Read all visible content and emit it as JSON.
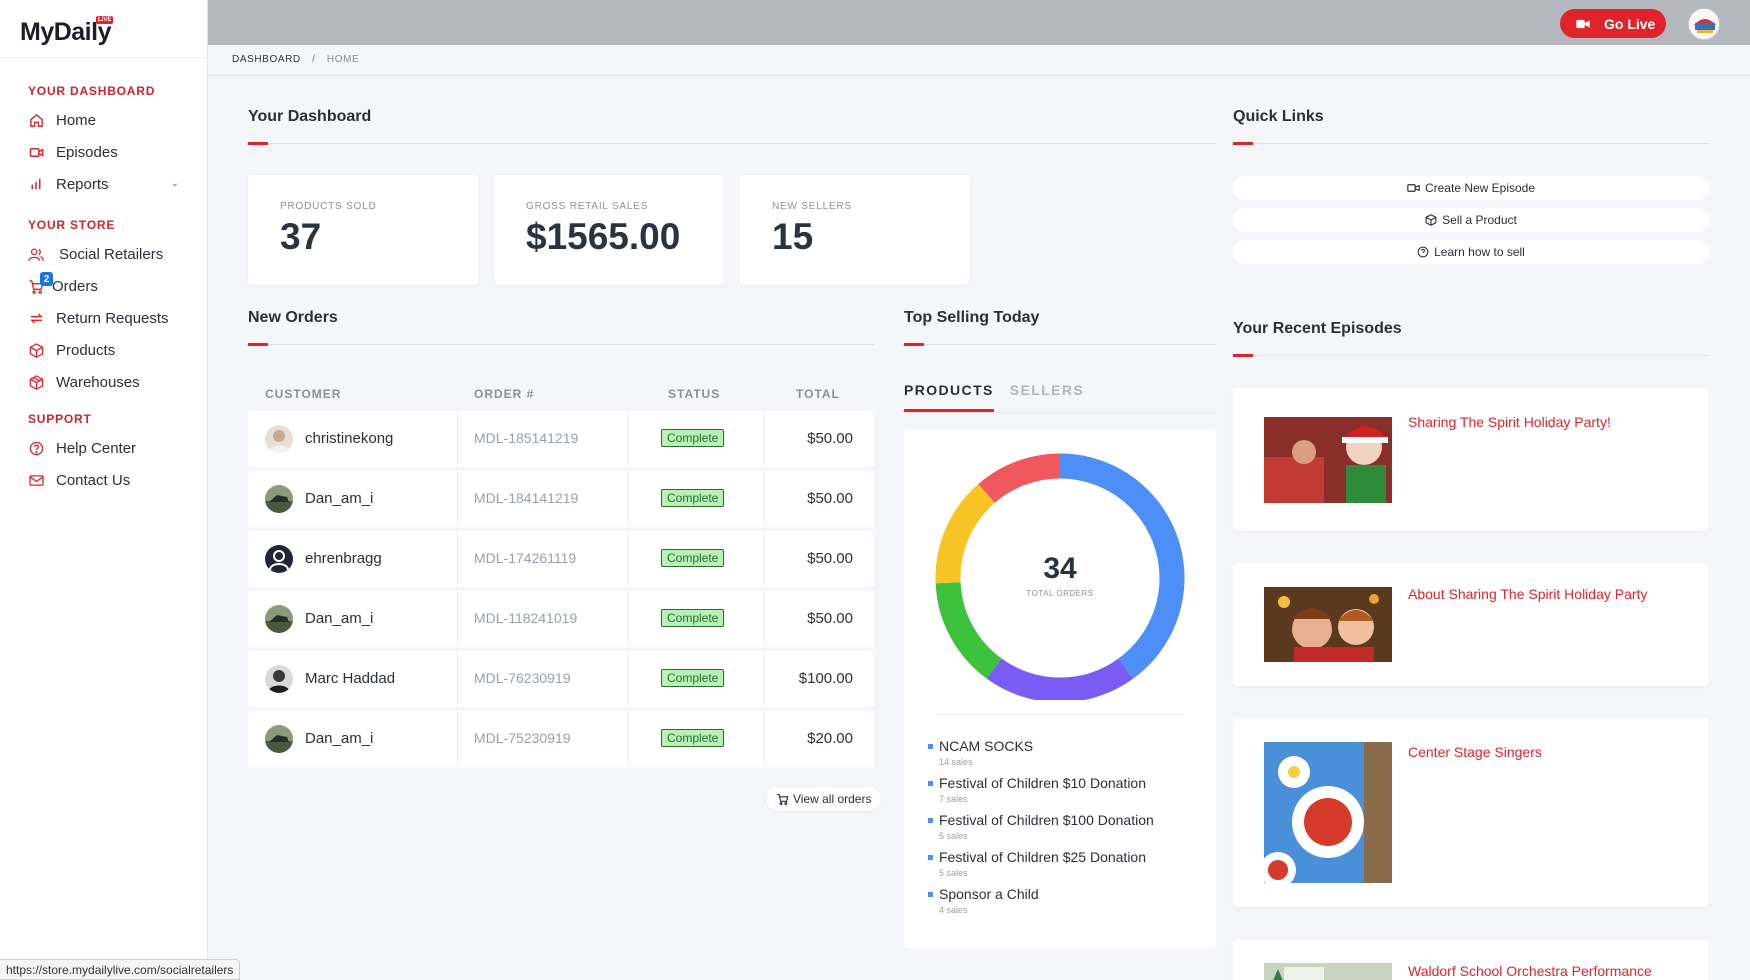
{
  "app": {
    "logo": "MyDaily",
    "logo_badge": "LIVE"
  },
  "sidebar": {
    "section_dashboard": "YOUR DASHBOARD",
    "section_store": "YOUR STORE",
    "section_support": "SUPPORT",
    "items": [
      {
        "label": "Home",
        "icon": "home-icon"
      },
      {
        "label": "Episodes",
        "icon": "video-camera-icon"
      },
      {
        "label": "Reports",
        "icon": "bar-chart-icon"
      },
      {
        "label": "Social Retailers",
        "icon": "users-icon"
      },
      {
        "label": "Orders",
        "icon": "cart-icon",
        "badge": "2"
      },
      {
        "label": "Return Requests",
        "icon": "swap-icon"
      },
      {
        "label": "Products",
        "icon": "box-icon"
      },
      {
        "label": "Warehouses",
        "icon": "warehouse-icon"
      },
      {
        "label": "Help Center",
        "icon": "question-circle-icon"
      },
      {
        "label": "Contact Us",
        "icon": "envelope-icon"
      }
    ]
  },
  "topbar": {
    "go_live": "Go Live"
  },
  "breadcrumb": {
    "root": "DASHBOARD",
    "sep": "/",
    "current": "HOME"
  },
  "dashboard": {
    "title": "Your Dashboard",
    "stats": [
      {
        "label": "PRODUCTS SOLD",
        "value": "37"
      },
      {
        "label": "GROSS RETAIL SALES",
        "value": "$1565.00"
      },
      {
        "label": "NEW SELLERS",
        "value": "15"
      }
    ]
  },
  "orders": {
    "title": "New Orders",
    "headers": [
      "CUSTOMER",
      "ORDER #",
      "STATUS",
      "TOTAL"
    ],
    "rows": [
      {
        "customer": "christinekong",
        "number": "MDL-185141219",
        "status": "Complete",
        "total": "$50.00"
      },
      {
        "customer": "Dan_am_i",
        "number": "MDL-184141219",
        "status": "Complete",
        "total": "$50.00"
      },
      {
        "customer": "ehrenbragg",
        "number": "MDL-174261119",
        "status": "Complete",
        "total": "$50.00"
      },
      {
        "customer": "Dan_am_i",
        "number": "MDL-118241019",
        "status": "Complete",
        "total": "$50.00"
      },
      {
        "customer": "Marc Haddad",
        "number": "MDL-76230919",
        "status": "Complete",
        "total": "$100.00"
      },
      {
        "customer": "Dan_am_i",
        "number": "MDL-75230919",
        "status": "Complete",
        "total": "$20.00"
      }
    ],
    "view_all": "View all orders"
  },
  "top_selling": {
    "title": "Top Selling Today",
    "tabs": [
      "PRODUCTS",
      "SELLERS"
    ],
    "total": "34",
    "total_label": "TOTAL ORDERS",
    "items": [
      {
        "name": "NCAM SOCKS",
        "sales": "14 sales"
      },
      {
        "name": "Festival of Children $10 Donation",
        "sales": "7 sales"
      },
      {
        "name": "Festival of Children $100 Donation",
        "sales": "5 sales"
      },
      {
        "name": "Festival of Children $25 Donation",
        "sales": "5 sales"
      },
      {
        "name": "Sponsor a Child",
        "sales": "4 sales"
      }
    ],
    "segment_colors": [
      "#4e8ef7",
      "#7a5cf5",
      "#3cc23c",
      "#f7c325",
      "#f0585e"
    ]
  },
  "quick_links": {
    "title": "Quick Links",
    "links": [
      "Create New Episode",
      "Sell a Product",
      "Learn how to sell"
    ]
  },
  "episodes": {
    "title": "Your Recent Episodes",
    "items": [
      "Sharing The Spirit Holiday Party!",
      "About Sharing The Spirit Holiday Party",
      "Center Stage Singers",
      "Waldorf School Orchestra Performance"
    ]
  },
  "status_bar": {
    "url": "https://store.mydailylive.com/socialretailers"
  },
  "colors": {
    "accent": "#e0242b",
    "complete_bg": "#b8f0b8"
  }
}
